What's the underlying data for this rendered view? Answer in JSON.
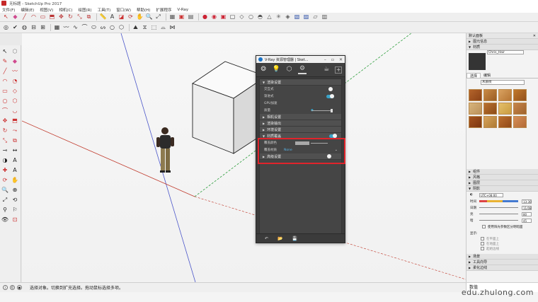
{
  "window": {
    "title": "无标题 - SketchUp Pro 2017"
  },
  "menu": [
    "文件(F)",
    "编辑(E)",
    "视图(V)",
    "相机(C)",
    "绘图(R)",
    "工具(T)",
    "窗口(W)",
    "帮助(H)",
    "扩展程序",
    "V-Ray"
  ],
  "vray": {
    "title": "V-Ray 资源管理器 | Sket...",
    "rollouts": [
      {
        "label": "渲染设置",
        "rows": [
          {
            "label": "交互式",
            "control": "toggle-off"
          },
          {
            "label": "渐进式",
            "control": "toggle-on"
          },
          {
            "label": "GPU加速",
            "control": "none"
          },
          {
            "label": "质量",
            "control": "slider"
          }
        ]
      },
      {
        "label": "相机设置"
      },
      {
        "label": "渲染输出"
      },
      {
        "label": "环境设置"
      }
    ],
    "material_override": {
      "label": "材质覆盖",
      "rows": [
        {
          "label": "覆盖颜色"
        },
        {
          "label": "覆盖材质",
          "value": "None"
        }
      ]
    },
    "last_rollout": "高级设置"
  },
  "tray": {
    "title": "默认面板",
    "sections_top": [
      "图元信息",
      "材质"
    ],
    "material_name": "Chris_Hair",
    "tabs": [
      "选择",
      "编辑"
    ],
    "library": "木质纹",
    "sections_mid": [
      "组件",
      "风格",
      "图层",
      "阴影"
    ],
    "shadow": {
      "timezone": "UTC+08:00",
      "time_label": "时间",
      "date_label": "日期",
      "time_value": "13:30",
      "date_value": "11/08",
      "light_label": "亮",
      "dark_label": "暗",
      "light_value": "80",
      "dark_value": "45",
      "sun_shading_label": "使用阳光参数区分明暗面",
      "display_label": "显示:",
      "display_options": [
        "在平面上",
        "在地面上",
        "起始边线"
      ]
    },
    "sections_bottom": [
      "场景",
      "工具向导",
      "柔化边线"
    ]
  },
  "status": {
    "message": "选择对象。切换到扩充选择。拖动鼠标选择多项。",
    "measurement_label": "数值"
  },
  "watermark": "edu.zhulong.com",
  "colors": {
    "red_highlight": "#e0242b",
    "vray_panel": "#3b3b3b",
    "toggle_on": "#3aa3c8",
    "axis_red": "#c0392b",
    "axis_green": "#2e9e3d",
    "axis_blue": "#4a55c9"
  }
}
